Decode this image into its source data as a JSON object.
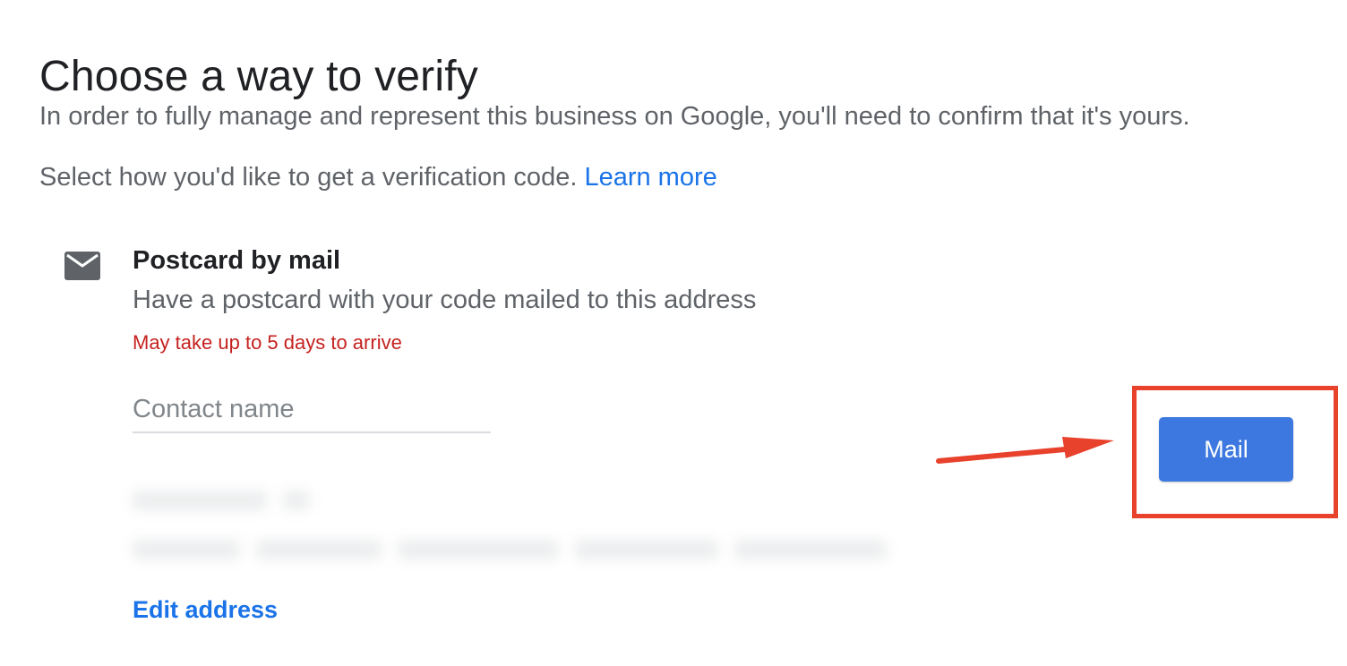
{
  "page": {
    "title": "Choose a way to verify",
    "intro": "In order to fully manage and represent this business on Google, you'll need to confirm that it's yours.",
    "select_prefix": "Select how you'd like to get a verification code. ",
    "learn_more": "Learn more"
  },
  "option": {
    "icon": "envelope-icon",
    "title": "Postcard by mail",
    "description": "Have a postcard with your code mailed to this address",
    "warning": "May take up to 5 days to arrive",
    "contact_name": {
      "placeholder": "Contact name",
      "value": ""
    },
    "edit_address": "Edit address"
  },
  "actions": {
    "mail_button": "Mail"
  },
  "annotation": {
    "highlight_color": "#e8412c",
    "target": "mail-button"
  },
  "colors": {
    "accent": "#1a73e8",
    "button": "#3c78e0",
    "warning": "#c5221f",
    "annotation": "#e8412c"
  }
}
